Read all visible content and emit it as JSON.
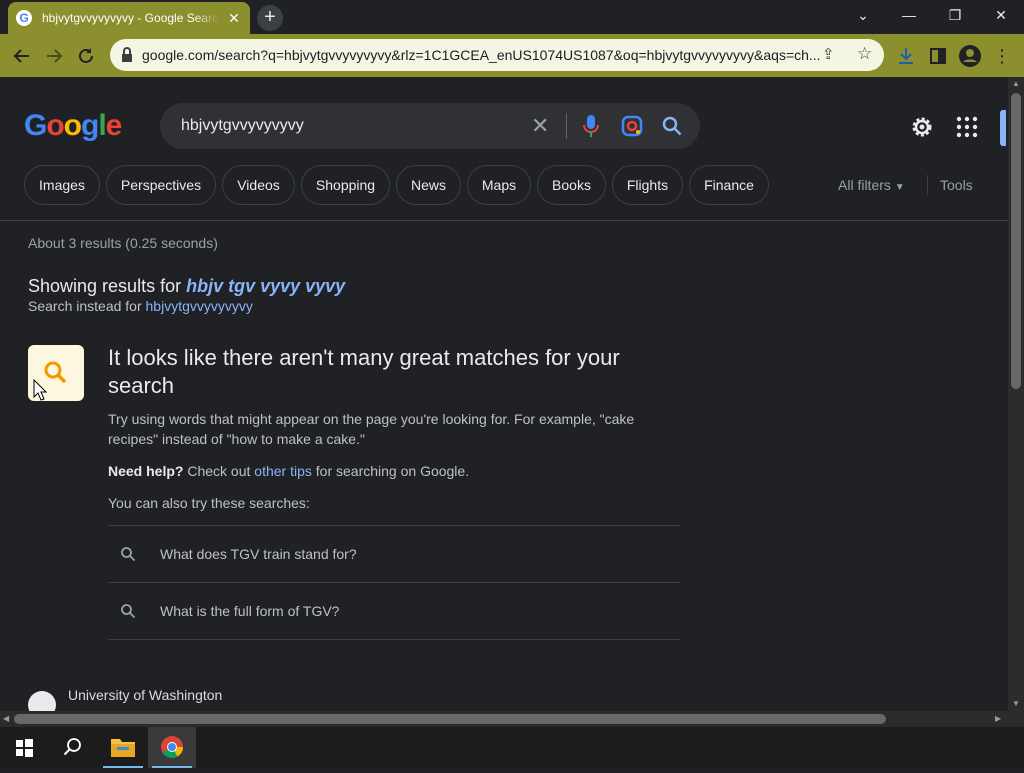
{
  "browser": {
    "tab_title": "hbjvytgvvyvyvyvy - Google Search",
    "tab_favicon": "G",
    "new_tab_label": "+",
    "url": "google.com/search?q=hbjvytgvvyvyvyvy&rlz=1C1GCEA_enUS1074US1087&oq=hbjvytgvvyvyvyvy&aqs=ch...",
    "accent_color": "#8b8f2e"
  },
  "google": {
    "logo_letters": [
      "G",
      "o",
      "o",
      "g",
      "l",
      "e"
    ],
    "query": "hbjvytgvvyvyvyvy",
    "chips": [
      "Images",
      "Perspectives",
      "Videos",
      "Shopping",
      "News",
      "Maps",
      "Books",
      "Flights",
      "Finance"
    ],
    "all_filters": "All filters",
    "tools": "Tools"
  },
  "results": {
    "stats": "About 3 results (0.25 seconds)",
    "showing_prefix": "Showing results for",
    "corrected_query": "hbjv tgv vyvy vyvy",
    "instead_prefix": "Search instead for",
    "original_query": "hbjvytgvvyvyvyvy",
    "tip_title": "It looks like there aren't many great matches for your search",
    "tip_body": "Try using words that might appear on the page you're looking for. For example, \"cake recipes\" instead of \"how to make a cake.\"",
    "need_help_label": "Need help?",
    "need_help_text1": "Check out",
    "need_help_link": "other tips",
    "need_help_text2": "for searching on Google.",
    "also_try": "You can also try these searches:",
    "suggestions": [
      "What does TGV train stand for?",
      "What is the full form of TGV?"
    ],
    "first_result_site": "University of Washington"
  },
  "taskbar": {
    "items": [
      "start-icon",
      "search-icon",
      "file-explorer-icon",
      "chrome-icon"
    ]
  }
}
